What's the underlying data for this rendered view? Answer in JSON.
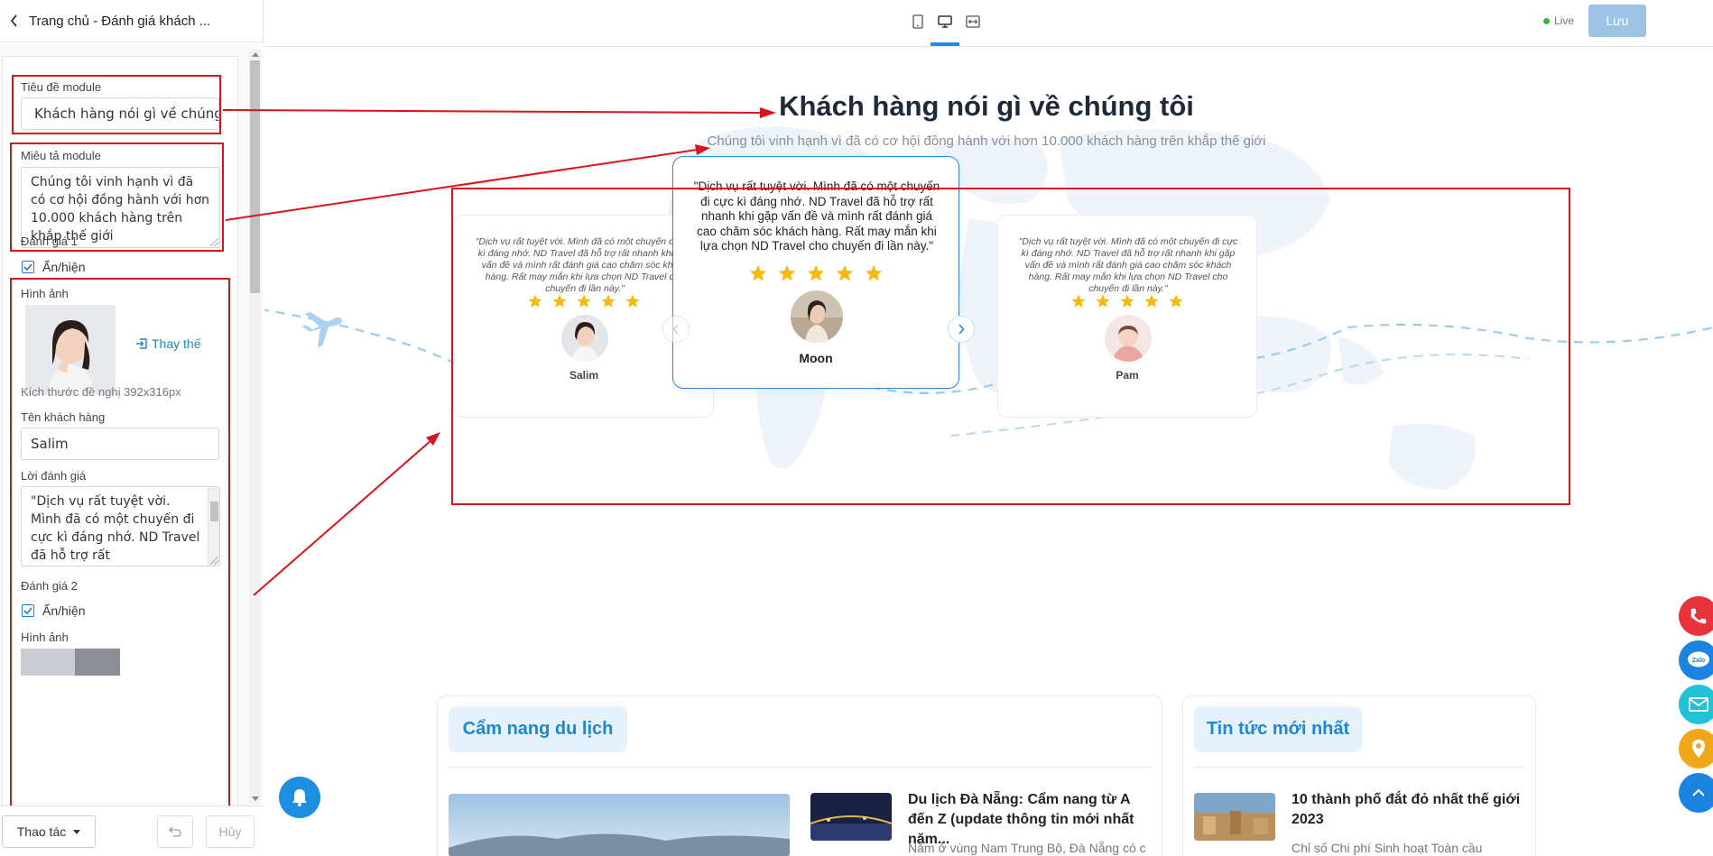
{
  "editor": {
    "title": "Trang chủ - Đánh giá khách ...",
    "module_title_label": "Tiêu đề module",
    "module_title_value": "Khách hàng nói gì về chúng tôi",
    "module_desc_label": "Miêu tả module",
    "module_desc_value": "Chúng tôi vinh hạnh vì đã có cơ hội đồng hành với hơn 10.000 khách hàng trên khắp thế giới",
    "review1": {
      "heading": "Đánh giá 1",
      "toggle_label": "Ẩn/hiện",
      "image_label": "Hình ảnh",
      "replace_label": "Thay thế",
      "size_hint": "Kích thước đề nghị 392x316px",
      "name_label": "Tên khách hàng",
      "name_value": "Salim",
      "review_label": "Lời đánh giá",
      "review_value": "\"Dịch vụ rất tuyệt vời. Mình đã có một chuyến đi cực kì đáng nhớ. ND Travel đã hỗ trợ rất"
    },
    "review2": {
      "heading": "Đánh giá 2",
      "toggle_label": "Ẩn/hiện",
      "image_label": "Hình ảnh"
    },
    "footer": {
      "action_label": "Thao tác",
      "cancel_label": "Hủy"
    }
  },
  "toolbar": {
    "live_label": "Live",
    "save_label": "Lưu"
  },
  "section": {
    "title": "Khách hàng nói gì về chúng tôi",
    "subtitle": "Chúng tôi vinh hạnh vì đã có cơ hội đồng hành với hơn 10.000 khách hàng trên khắp thế giới"
  },
  "testimonials": [
    {
      "quote": "\"Dịch vụ rất tuyệt vời. Mình đã có một chuyến đi cực kì đáng nhớ. ND Travel đã hỗ trợ rất nhanh khi gặp vấn đề và mình rất đánh giá cao chăm sóc khách hàng. Rất may mắn khi lựa chọn ND Travel cho chuyến đi lần này.\"",
      "rating": 5,
      "name": "Salim"
    },
    {
      "quote": "\"Dịch vụ rất tuyệt vời. Mình đã có một chuyến đi cực kì đáng nhớ. ND Travel đã hỗ trợ rất nhanh khi gặp vấn đề và mình rất đánh giá cao chăm sóc khách hàng. Rất may mắn khi lựa chọn ND Travel cho chuyến đi lần này.\"",
      "rating": 5,
      "name": "Moon"
    },
    {
      "quote": "\"Dịch vụ rất tuyệt vời. Mình đã có một chuyến đi cực kì đáng nhớ. ND Travel đã hỗ trợ rất nhanh khi gặp vấn đề và mình rất đánh giá cao chăm sóc khách hàng. Rất may mắn khi lựa chọn ND Travel cho chuyến đi lần này.\"",
      "rating": 5,
      "name": "Pam"
    }
  ],
  "guide": {
    "tag": "Cẩm nang du lịch",
    "item_title": "Du lịch Đà Nẵng: Cẩm nang từ A đến Z (update thông tin mới nhất năm...",
    "item_desc": "Nằm ở vùng Nam Trung Bộ, Đà Nẵng có cả"
  },
  "news": {
    "tag": "Tin tức mới nhất",
    "item_title": "10 thành phố đắt đỏ nhất thế giới 2023",
    "item_desc": "Chỉ số Chi phí Sinh hoạt Toàn cầu"
  },
  "colors": {
    "accent": "#2b88d8",
    "annotation_red": "#d9141c",
    "star": "#f5b90f",
    "phone": "#e8323c",
    "zalo": "#1b84e0",
    "mail": "#1fc2d6",
    "map": "#f0a81a",
    "scroll_top": "#1b84e0"
  }
}
